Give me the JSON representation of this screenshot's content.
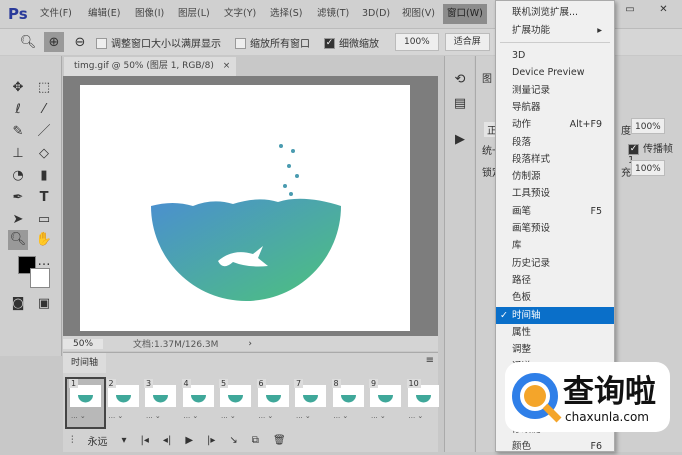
{
  "app": {
    "logo": "Ps"
  },
  "menubar": [
    "文件(F)",
    "编辑(E)",
    "图像(I)",
    "图层(L)",
    "文字(Y)",
    "选择(S)",
    "滤镜(T)",
    "3D(D)",
    "视图(V)",
    "窗口(W)"
  ],
  "options": {
    "fit_screen": "调整窗口大小以满屏显示",
    "zoom_all": "缩放所有窗口",
    "scrubby": "细微缩放",
    "zoom_value": "100%",
    "fit_label": "适合屏"
  },
  "document": {
    "tab": "timg.gif @ 50% (图层 1, RGB/8)",
    "close": "×",
    "zoom": "50%",
    "doc_info": "文档:1.37M/126.3M",
    "arrow": "›"
  },
  "timeline": {
    "title": "时间轴",
    "loop": "永远",
    "frames": [
      "1",
      "2",
      "3",
      "4",
      "5",
      "6",
      "7",
      "8",
      "9",
      "10"
    ],
    "delay": "..."
  },
  "right_panel": {
    "tab": "图",
    "opacity_label": "度:",
    "opacity": "100%",
    "propagate": "传播帧",
    "propagate_val": "1",
    "fill_label": "充:",
    "fill": "100%",
    "mode": "正",
    "unify": "统一",
    "lock": "锁定"
  },
  "window_menu": {
    "top": [
      {
        "label": "联机浏览扩展..."
      },
      {
        "label": "扩展功能",
        "submenu": true
      }
    ],
    "items": [
      {
        "label": "3D"
      },
      {
        "label": "Device Preview"
      },
      {
        "label": "测量记录"
      },
      {
        "label": "导航器"
      },
      {
        "label": "动作",
        "shortcut": "Alt+F9"
      },
      {
        "label": "段落"
      },
      {
        "label": "段落样式"
      },
      {
        "label": "仿制源"
      },
      {
        "label": "工具预设"
      },
      {
        "label": "画笔",
        "shortcut": "F5"
      },
      {
        "label": "画笔预设"
      },
      {
        "label": "库"
      },
      {
        "label": "历史记录"
      },
      {
        "label": "路径"
      },
      {
        "label": "色板"
      },
      {
        "label": "时间轴",
        "checked": true
      },
      {
        "label": "属性"
      },
      {
        "label": "调整"
      },
      {
        "label": "通道"
      }
    ],
    "bottom": [
      {
        "label": "修改键"
      },
      {
        "label": "颜色",
        "shortcut": "F6"
      }
    ]
  },
  "watermark": {
    "title": "查询啦",
    "url": "chaxunla.com"
  },
  "colors": {
    "menu_selected": "#0a6fc9",
    "bowl_start": "#4b8fd0",
    "bowl_end": "#4cc27c"
  }
}
